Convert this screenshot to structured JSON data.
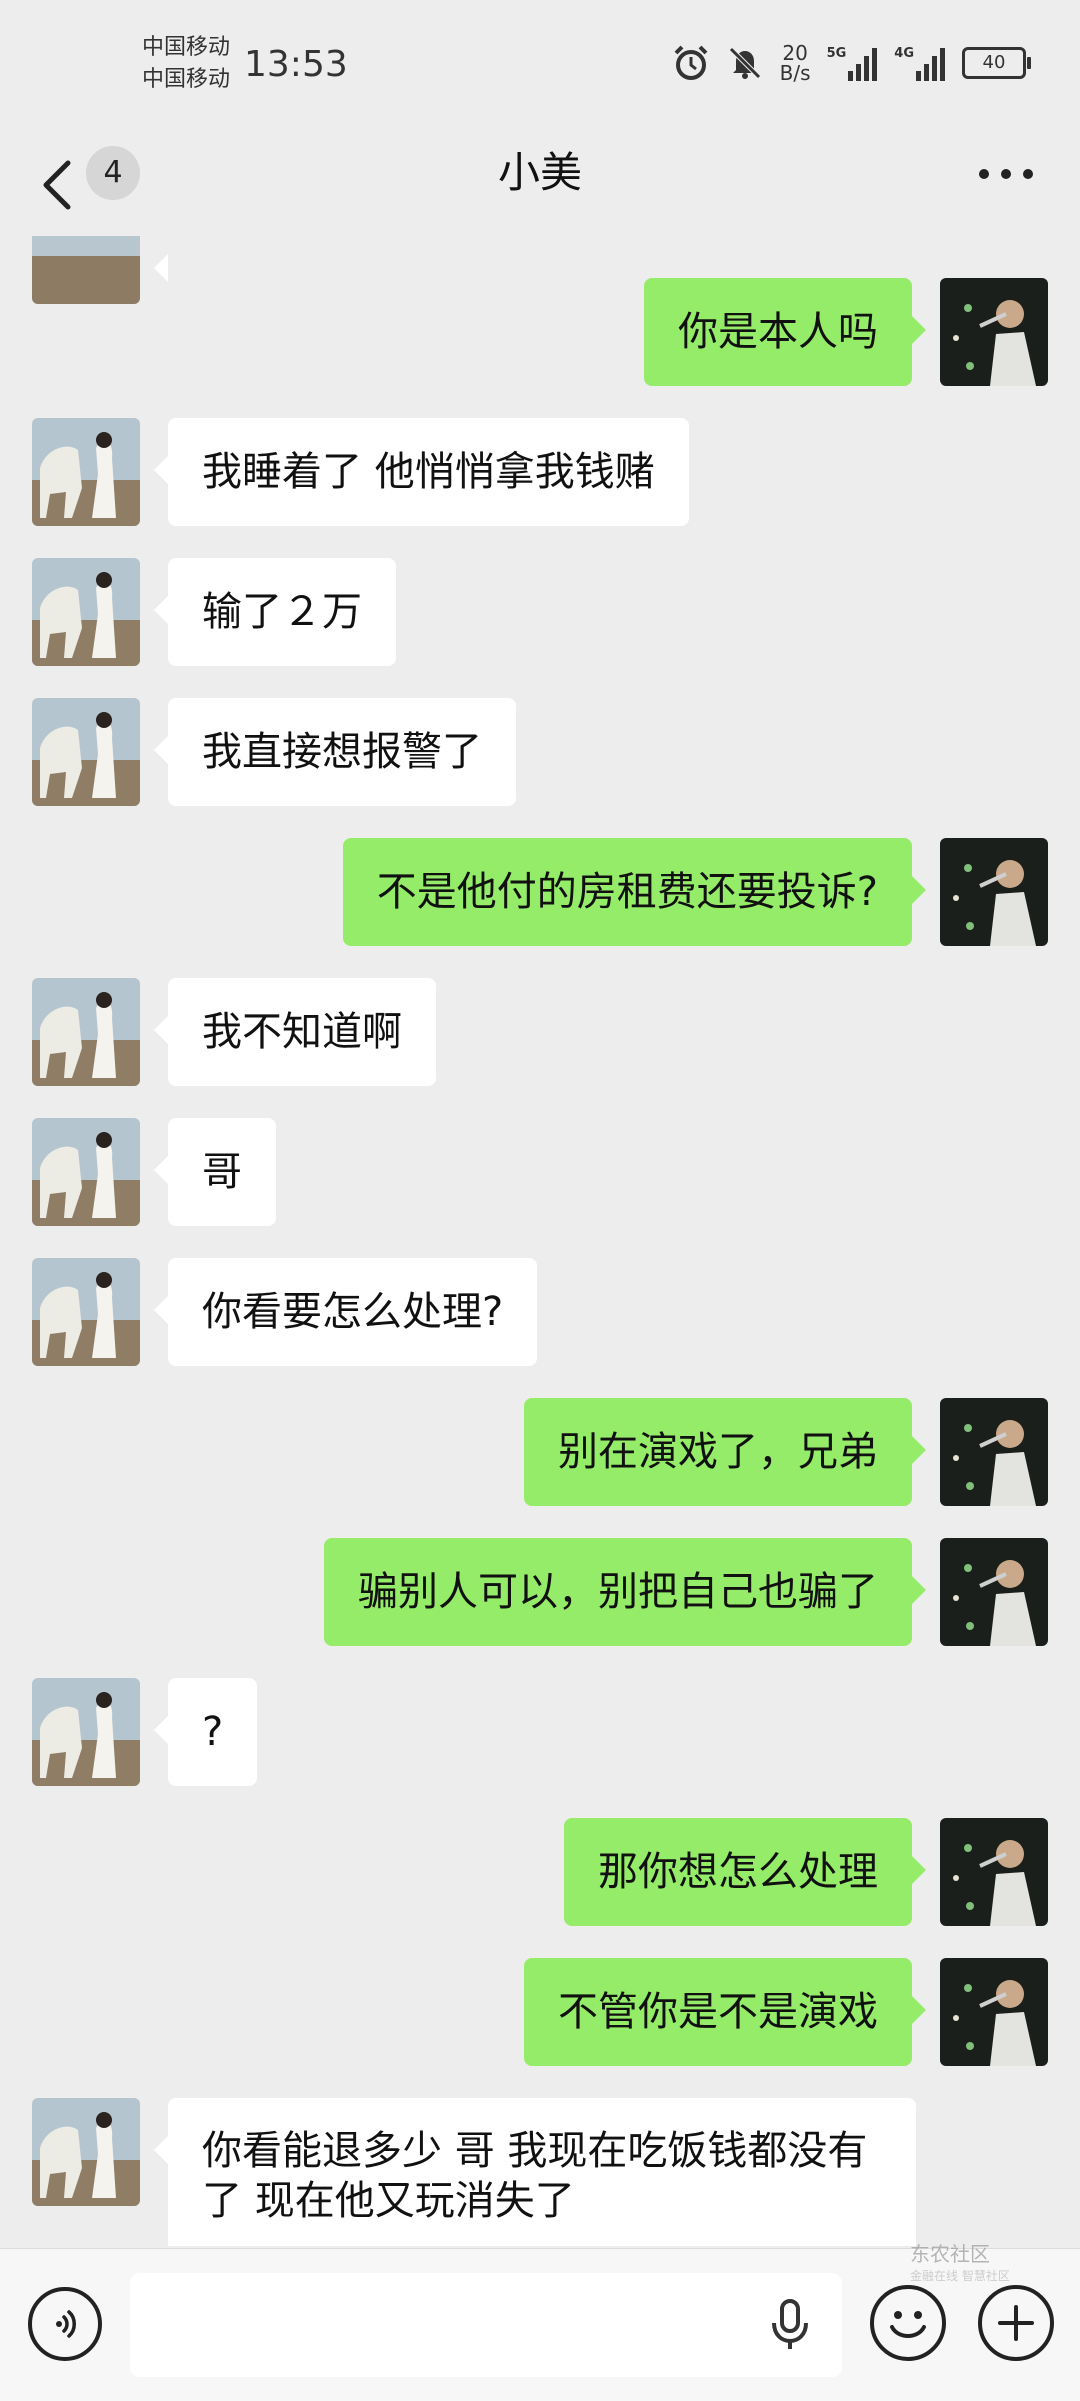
{
  "status_bar": {
    "carrier_1": "中国移动",
    "carrier_2": "中国移动",
    "time": "13:53",
    "net_speed_value": "20",
    "net_speed_unit": "B/s",
    "signal_1_label": "5G",
    "signal_2_label": "4G",
    "battery": "40"
  },
  "nav": {
    "unread_count": "4",
    "title": "小美"
  },
  "messages": [
    {
      "side": "out",
      "text": "你是本人吗"
    },
    {
      "side": "in",
      "text": "我睡着了 他悄悄拿我钱赌"
    },
    {
      "side": "in",
      "text": "输了２万"
    },
    {
      "side": "in",
      "text": "我直接想报警了"
    },
    {
      "side": "out",
      "text": "不是他付的房租费还要投诉?"
    },
    {
      "side": "in",
      "text": "我不知道啊"
    },
    {
      "side": "in",
      "text": "哥"
    },
    {
      "side": "in",
      "text": "你看要怎么处理?"
    },
    {
      "side": "out",
      "text": "别在演戏了，兄弟"
    },
    {
      "side": "out",
      "text": "骗别人可以，别把自己也骗了"
    },
    {
      "side": "in",
      "text": "?"
    },
    {
      "side": "out",
      "text": "那你想怎么处理"
    },
    {
      "side": "out",
      "text": "不管你是不是演戏"
    },
    {
      "side": "in",
      "text": "你看能退多少 哥 我现在吃饭钱都没有了 现在他又玩消失了"
    }
  ],
  "input_bar": {
    "placeholder": ""
  },
  "watermark": {
    "line1": "东农社区",
    "line2": "金融在线 智慧社区"
  },
  "colors": {
    "background": "#ededed",
    "outgoing_bubble": "#95ec69",
    "incoming_bubble": "#ffffff"
  },
  "icons": {
    "back": "chevron-left-icon",
    "more": "more-dots-icon",
    "voice": "voice-icon",
    "mic": "mic-icon",
    "emoji": "emoji-icon",
    "plus": "plus-icon",
    "alarm": "alarm-icon",
    "mute": "bell-muted-icon"
  }
}
